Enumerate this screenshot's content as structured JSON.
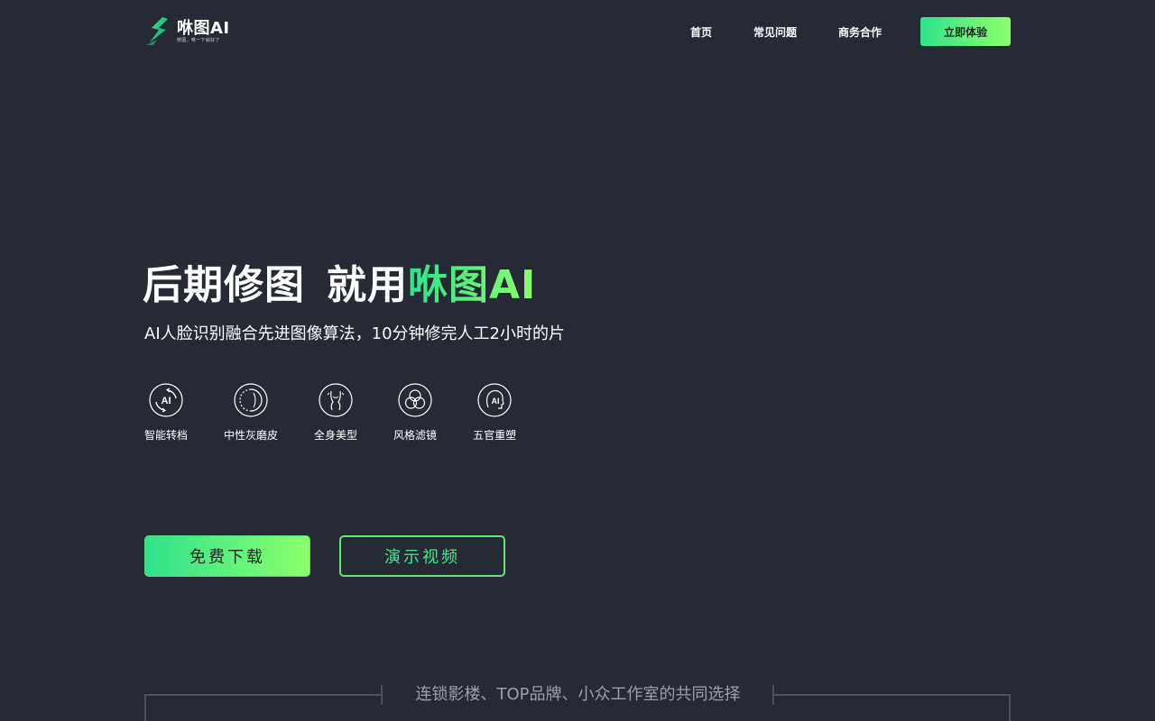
{
  "brand": {
    "name": "咻图AI",
    "slogan": "修图，咻一下就好了",
    "accent_start": "#2fe28d",
    "accent_end": "#8cff6b",
    "background": "#252a35"
  },
  "nav": {
    "items": [
      {
        "label": "首页"
      },
      {
        "label": "常见问题"
      },
      {
        "label": "商务合作"
      }
    ],
    "cta_label": "立即体验"
  },
  "hero": {
    "title_prefix": "后期修图",
    "title_middle": "就用",
    "title_brand": "咻图AI",
    "subtitle": "AI人脸识别融合先进图像算法，10分钟修完人工2小时的片"
  },
  "features": [
    {
      "label": "智能转档",
      "icon": "ai-convert-icon"
    },
    {
      "label": "中性灰磨皮",
      "icon": "skin-smoothing-icon"
    },
    {
      "label": "全身美型",
      "icon": "body-shaping-icon"
    },
    {
      "label": "风格滤镜",
      "icon": "style-filter-icon"
    },
    {
      "label": "五官重塑",
      "icon": "face-reshape-icon"
    }
  ],
  "actions": {
    "download_label": "免费下载",
    "video_label": "演示视频"
  },
  "partners": {
    "title": "连锁影楼、TOP品牌、小众工作室的共同选择"
  }
}
